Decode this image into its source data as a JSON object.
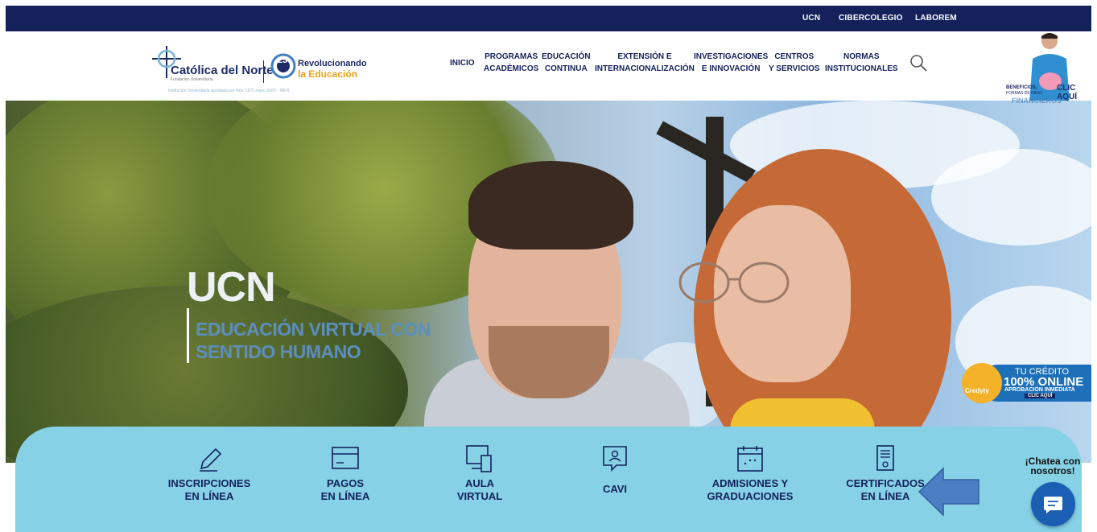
{
  "topbar": {
    "links": [
      "UCN",
      "CIBERCOLEGIO",
      "LABOREM"
    ]
  },
  "logo": {
    "name": "Católica del Norte",
    "sub": "Fundación Universitaria",
    "anniversary": "25",
    "slogan_line1": "Revolucionando",
    "slogan_line2": "la Educación",
    "institution_note": "Institución Universitaria aprobada por Res. 1671 mayo 20/97 - MEN"
  },
  "nav": {
    "inicio": "INICIO",
    "programas": "PROGRAMAS\nACADÉMICOS",
    "educacion": "EDUCACIÓN\nCONTINUA",
    "extension": "EXTENSIÓN E\nINTERNACIONALIZACIÓN",
    "investigaciones": "INVESTIGACIONES\nE INNOVACIÓN",
    "centros": "CENTROS\nY SERVICIOS",
    "normas": "NORMAS\nINSTITUCIONALES"
  },
  "promo": {
    "beneficios": "BENEFICIOS,",
    "formas": "FORMAS DE PAGO",
    "clic": "CLIC AQUÍ",
    "financieros": "FINANCIEROS"
  },
  "hero": {
    "title": "UCN",
    "subtitle": "EDUCACIÓN VIRTUAL CON\nSENTIDO HUMANO"
  },
  "credyty": {
    "brand": "Credyty",
    "line1": "TU CRÉDITO",
    "line2": "100% ONLINE",
    "line3": "APROBACIÓN INMEDIATA",
    "cta": "CLIC AQUÍ"
  },
  "quick_access": [
    {
      "label": "INSCRIPCIONES\nEN LÍNEA",
      "icon": "pencil-icon"
    },
    {
      "label": "PAGOS\nEN LÍNEA",
      "icon": "payment-card-icon"
    },
    {
      "label": "AULA\nVIRTUAL",
      "icon": "computer-icon"
    },
    {
      "label": "CAVI",
      "icon": "user-chat-icon"
    },
    {
      "label": "ADMISIONES Y\nGRADUACIONES",
      "icon": "calendar-icon"
    },
    {
      "label": "CERTIFICADOS\nEN LÍNEA",
      "icon": "certificate-icon"
    }
  ],
  "chat": {
    "label": "¡Chatea con\nnosotros!"
  },
  "colors": {
    "navy": "#14215b",
    "panel": "#86d1e6",
    "accent_blue": "#1a5fb4",
    "arrow": "#4a7fc4"
  }
}
